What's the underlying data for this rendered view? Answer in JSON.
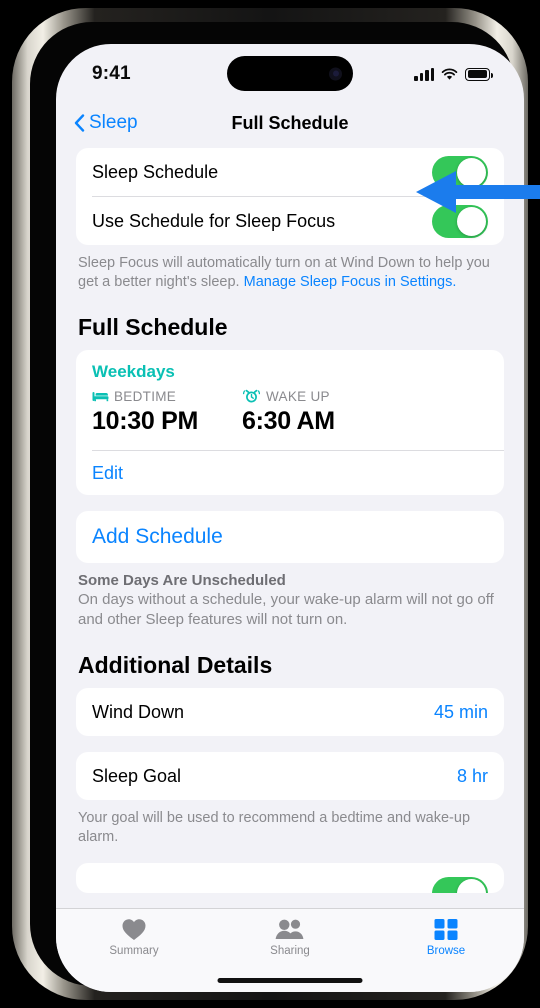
{
  "status_bar": {
    "time": "9:41",
    "cellular_icon": "signal-bars-icon",
    "wifi_icon": "wifi-icon",
    "battery_icon": "battery-full-icon"
  },
  "nav": {
    "back_label": "Sleep",
    "back_icon": "chevron-left-icon",
    "title": "Full Schedule"
  },
  "toggles": {
    "sleep_schedule_label": "Sleep Schedule",
    "sleep_schedule_state": "on",
    "use_schedule_focus_label": "Use Schedule for Sleep Focus",
    "use_schedule_focus_state": "on",
    "footnote_text": "Sleep Focus will automatically turn on at Wind Down to help you get a better night's sleep. ",
    "footnote_link": "Manage Sleep Focus in Settings."
  },
  "full_schedule": {
    "section_title": "Full Schedule",
    "days": "Weekdays",
    "bedtime_icon": "bed-icon",
    "bedtime_label": "BEDTIME",
    "bedtime_value": "10:30 PM",
    "wakeup_icon": "alarm-clock-icon",
    "wakeup_label": "WAKE UP",
    "wakeup_value": "6:30 AM",
    "edit_label": "Edit",
    "add_schedule_label": "Add Schedule",
    "note_title": "Some Days Are Unscheduled",
    "note_body": "On days without a schedule, your wake-up alarm will not go off and other Sleep features will not turn on."
  },
  "additional_details": {
    "section_title": "Additional Details",
    "wind_down_label": "Wind Down",
    "wind_down_value": "45 min",
    "sleep_goal_label": "Sleep Goal",
    "sleep_goal_value": "8 hr",
    "goal_footnote": "Your goal will be used to recommend a bedtime and wake-up alarm."
  },
  "tab_bar": {
    "tabs": [
      {
        "label": "Summary",
        "icon": "heart-icon",
        "active": false
      },
      {
        "label": "Sharing",
        "icon": "people-icon",
        "active": false
      },
      {
        "label": "Browse",
        "icon": "grid-icon",
        "active": true
      }
    ]
  },
  "annotation": {
    "arrow_icon": "left-arrow-annotation",
    "color": "#1b7ced",
    "points_at": "Sleep Schedule"
  },
  "colors": {
    "accent_blue": "#0a84ff",
    "toggle_green": "#34c759",
    "teal": "#0ac0b4",
    "screen_bg": "#f2f2f7"
  }
}
